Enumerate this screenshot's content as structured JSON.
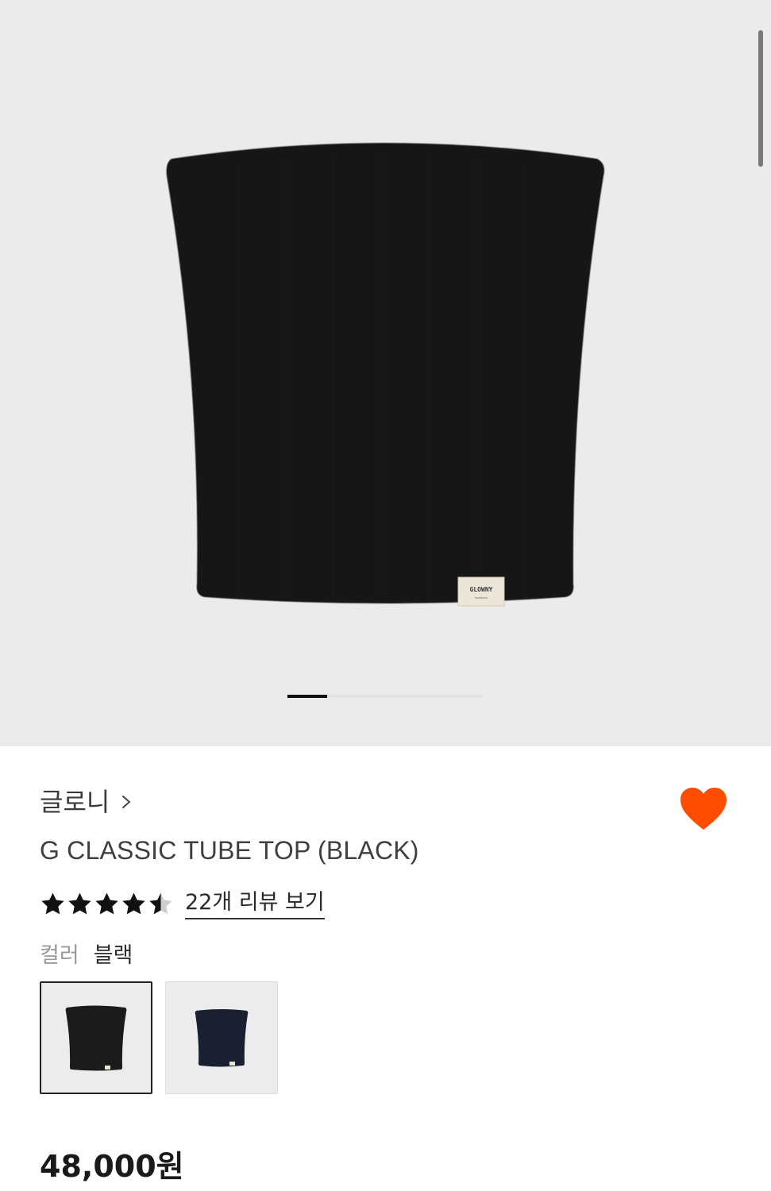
{
  "product": {
    "brand": "글로니",
    "title": "G CLASSIC TUBE TOP (BLACK)",
    "label_text": "GLOWNY",
    "rating": 4.5,
    "review_link": "22개 리뷰 보기",
    "color_label": "컬러",
    "color_value": "블랙",
    "price": "48,000원",
    "favorited": true
  },
  "gallery": {
    "current_index": 0,
    "indicator_fraction": 0.2
  },
  "swatches": [
    {
      "name": "black",
      "color": "#1c1c1c",
      "selected": true
    },
    {
      "name": "navy",
      "color": "#1b2030",
      "selected": false
    }
  ],
  "colors": {
    "hero_bg": "#ebebeb",
    "heart": "#ff4d00",
    "star": "#111111"
  },
  "icons": [
    "chevron-right-icon",
    "heart-icon",
    "star-icon",
    "half-star-icon"
  ]
}
